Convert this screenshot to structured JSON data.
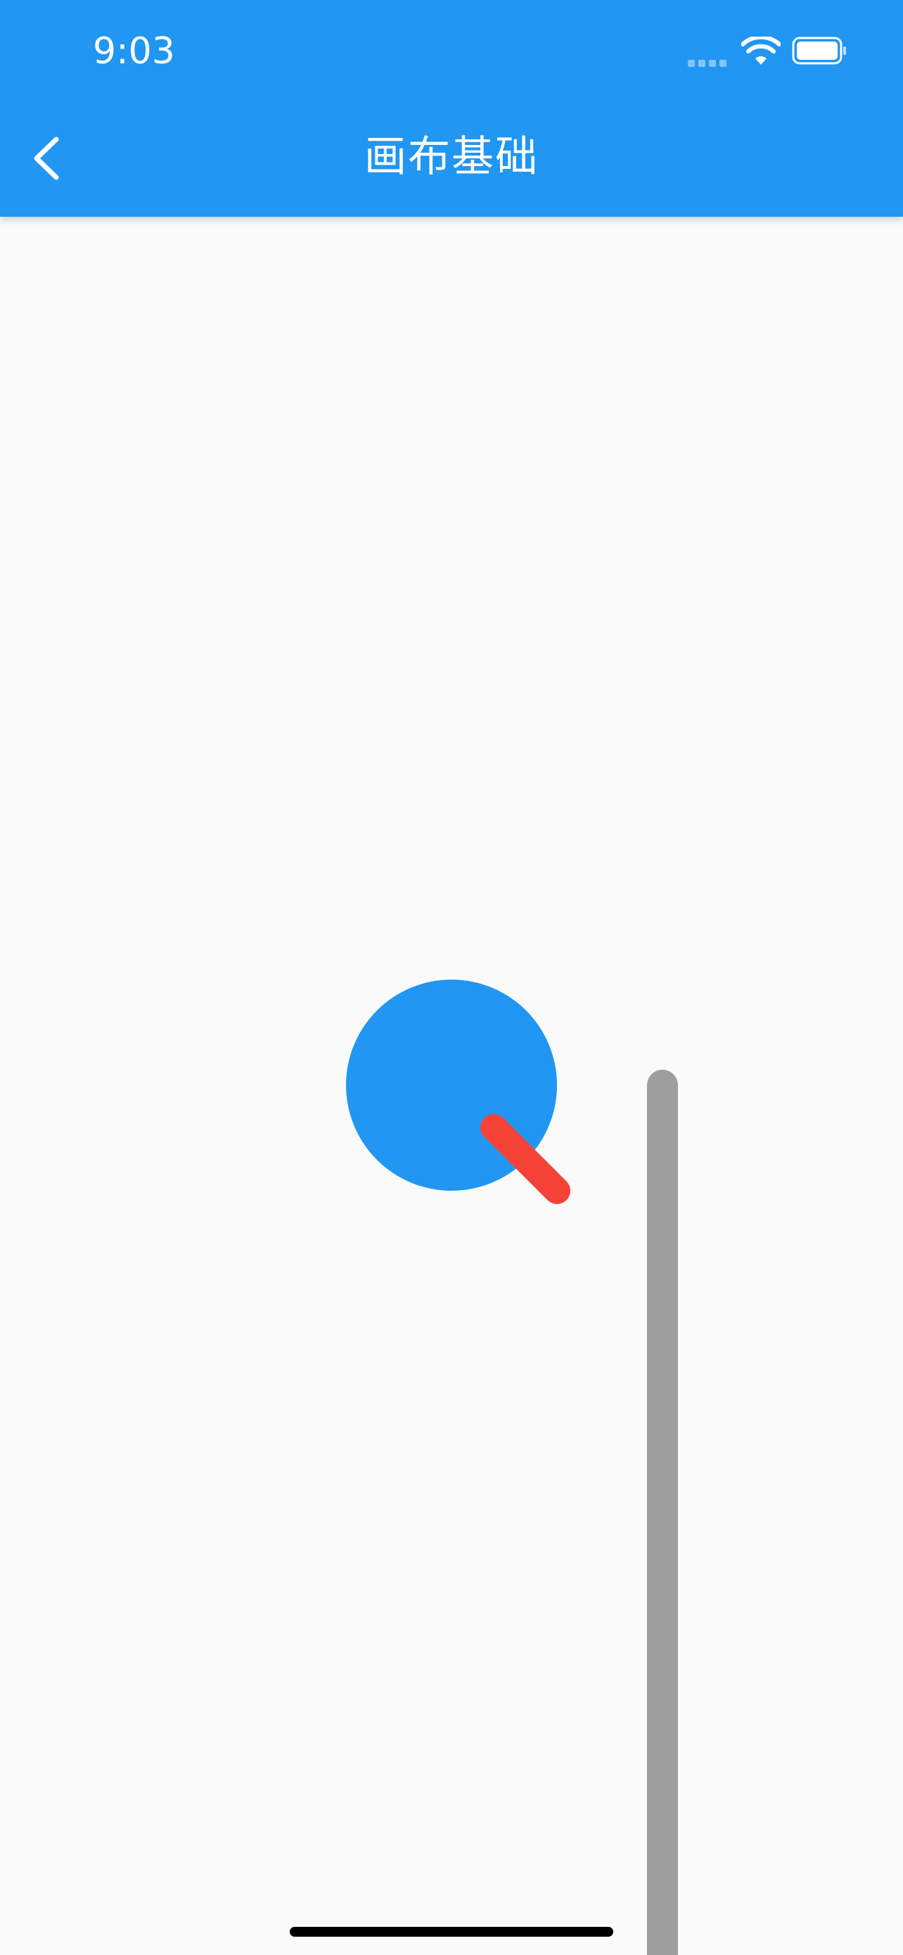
{
  "status_bar": {
    "time": "9:03",
    "wifi_icon": "wifi-icon",
    "battery_icon": "battery-icon",
    "signal_icon": "signal-icon"
  },
  "app_bar": {
    "title": "画布基础",
    "back_icon": "chevron-left-icon",
    "background_color": "#2196F3"
  },
  "canvas": {
    "background_color": "#FAFAFA",
    "shapes": [
      {
        "name": "blue-circle",
        "color": "#2196F3"
      },
      {
        "name": "red-line",
        "color": "#F44336"
      },
      {
        "name": "gray-line",
        "color": "#9E9E9E"
      }
    ]
  }
}
